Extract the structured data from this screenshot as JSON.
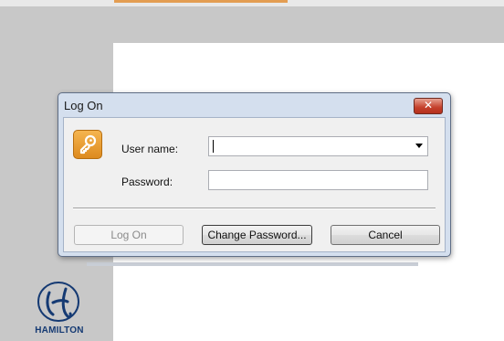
{
  "dialog": {
    "title": "Log On",
    "close_label": "✕",
    "user_name_label": "User name:",
    "user_name_value": "",
    "password_label": "Password:",
    "password_value": "",
    "buttons": {
      "logon": "Log On",
      "change_password": "Change Password...",
      "cancel": "Cancel"
    }
  },
  "branding": {
    "logo_text": "HAMILTON",
    "logo_color": "#153a73"
  },
  "icons": {
    "dialog_icon": "key-icon",
    "combo_arrow": "chevron-down-icon"
  },
  "colors": {
    "background_gray": "#c8c8c8",
    "dialog_frame": "#d4dfee",
    "close_button": "#c4402b",
    "key_icon": "#e39a2c"
  }
}
